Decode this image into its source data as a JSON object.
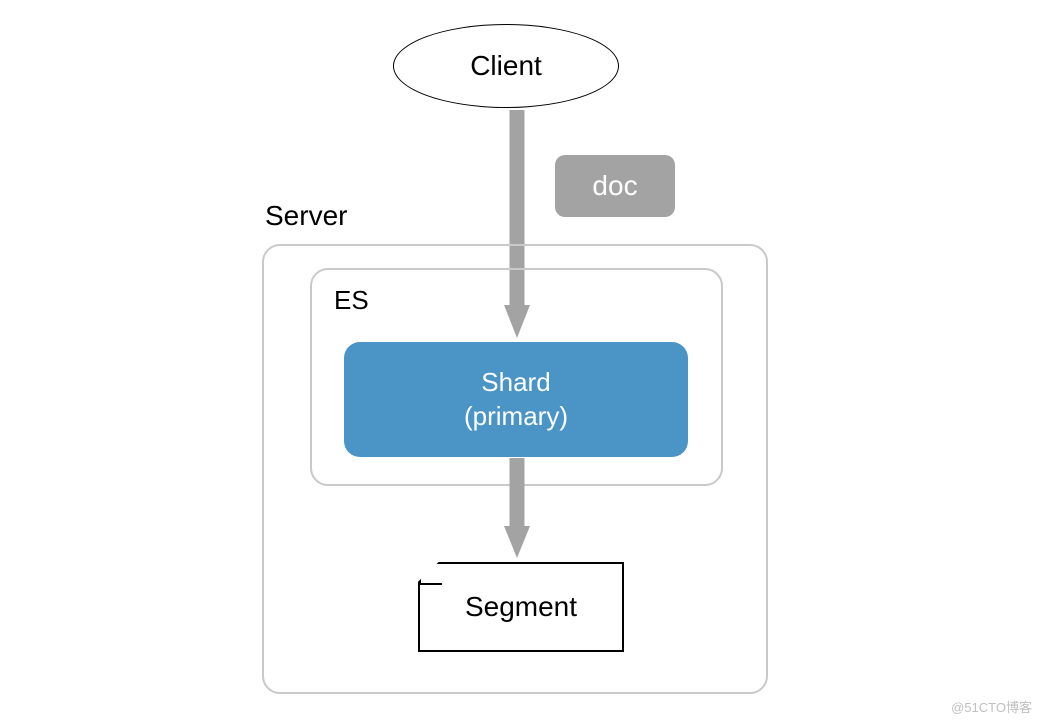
{
  "client": {
    "label": "Client"
  },
  "doc": {
    "label": "doc"
  },
  "server": {
    "label": "Server"
  },
  "es": {
    "label": "ES"
  },
  "shard": {
    "line1": "Shard",
    "line2": "(primary)"
  },
  "segment": {
    "label": "Segment"
  },
  "watermark": "@51CTO博客",
  "colors": {
    "arrow": "#a3a3a3",
    "shard_bg": "#4a95c6",
    "border_gray": "#c9c9c9"
  }
}
